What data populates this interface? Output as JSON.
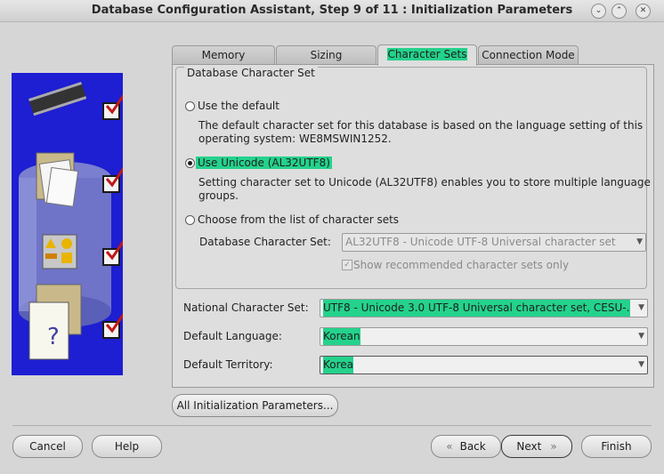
{
  "window": {
    "title": "Database Configuration Assistant, Step 9 of 11 : Initialization Parameters",
    "minimize_glyph": "⌄",
    "maximize_glyph": "⌃",
    "close_glyph": "✕"
  },
  "tabs": [
    {
      "label": "Memory"
    },
    {
      "label": "Sizing"
    },
    {
      "label": "Character Sets"
    },
    {
      "label": "Connection Mode"
    }
  ],
  "selected_tab": "Character Sets",
  "database_charset": {
    "legend": "Database Character Set",
    "options": [
      {
        "label": "Use the default",
        "selected": false,
        "description_line1": "The default character set for this database is based on the language setting of this",
        "description_line2": "operating system: WE8MSWIN1252."
      },
      {
        "label": "Use Unicode (AL32UTF8)",
        "selected": true,
        "description_line1": "Setting character set to Unicode (AL32UTF8) enables you to store multiple language",
        "description_line2": "groups."
      },
      {
        "label": "Choose from the list of character sets",
        "selected": false
      }
    ],
    "list_label": "Database Character Set:",
    "list_value": "AL32UTF8 - Unicode UTF-8 Universal character set",
    "show_recommended_label": "Show recommended character sets only",
    "show_recommended_checked": true
  },
  "national_charset": {
    "label": "National Character Set:",
    "value": "UTF8 - Unicode 3.0 UTF-8 Universal character set, CESU-..."
  },
  "default_language": {
    "label": "Default Language:",
    "value": "Korean"
  },
  "default_territory": {
    "label": "Default Territory:",
    "value": "Korea"
  },
  "all_params_button": "All Initialization Parameters...",
  "buttons": {
    "cancel": "Cancel",
    "help": "Help",
    "back": "Back",
    "back_glyph": "«",
    "next": "Next",
    "next_glyph": "»",
    "finish": "Finish"
  },
  "colors": {
    "highlight": "#24d28c",
    "wizard_panel": "#1e1ed2"
  }
}
